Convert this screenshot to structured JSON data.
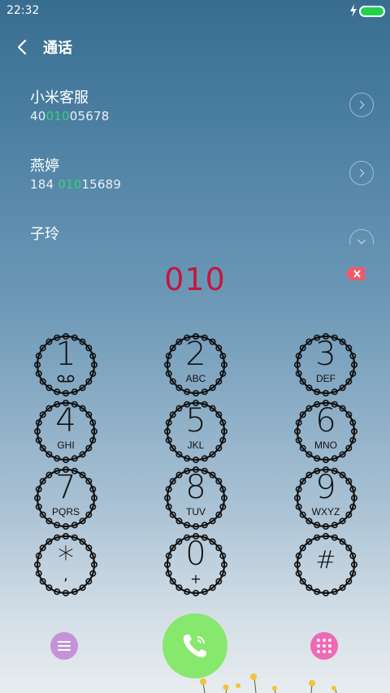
{
  "status_bar": {
    "time": "22:32",
    "charging_icon": "bolt-icon",
    "battery_color": "#22d24a"
  },
  "header": {
    "back_icon": "chevron-left-icon",
    "title": "通话"
  },
  "contacts": [
    {
      "name": "小米客服",
      "number_pre": "40",
      "number_match": "010",
      "number_post": "05678"
    },
    {
      "name": "燕婷",
      "number_pre": "184 ",
      "number_match": "010",
      "number_post": "15689"
    },
    {
      "name": "子玲",
      "number_pre": "",
      "number_match": "",
      "number_post": ""
    }
  ],
  "dial": {
    "input": "010",
    "input_color": "#c2183f",
    "backspace_icon": "backspace-icon"
  },
  "keypad": {
    "keys": [
      {
        "digit": "1",
        "letters": "",
        "icon": "voicemail-icon"
      },
      {
        "digit": "2",
        "letters": "ABC"
      },
      {
        "digit": "3",
        "letters": "DEF"
      },
      {
        "digit": "4",
        "letters": "GHI"
      },
      {
        "digit": "5",
        "letters": "JKL"
      },
      {
        "digit": "6",
        "letters": "MNO"
      },
      {
        "digit": "7",
        "letters": "PQRS"
      },
      {
        "digit": "8",
        "letters": "TUV"
      },
      {
        "digit": "9",
        "letters": "WXYZ"
      },
      {
        "digit": "*",
        "letters": ","
      },
      {
        "digit": "0",
        "letters": "+"
      },
      {
        "digit": "#",
        "letters": ""
      }
    ]
  },
  "bottom": {
    "menu_icon": "menu-icon",
    "call_icon": "phone-icon",
    "keypad_icon": "dialpad-icon",
    "menu_color": "#c592d9",
    "call_color": "#86e86c",
    "keypad_color": "#f068b6"
  }
}
